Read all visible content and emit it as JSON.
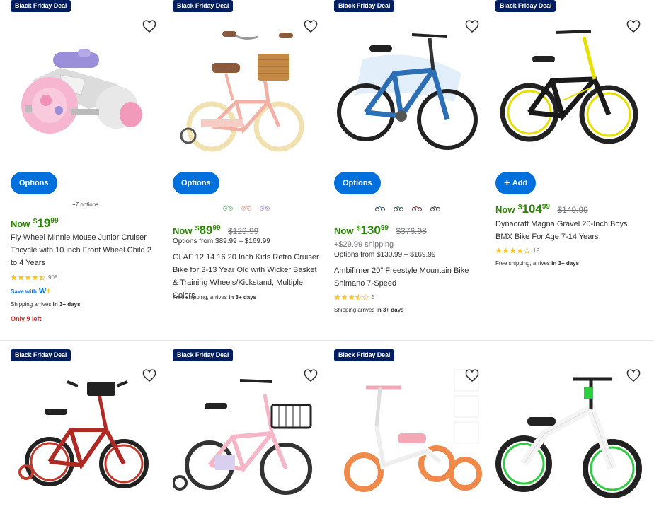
{
  "colors": {
    "green": "#2a8703",
    "blue": "#0071dc",
    "navy": "#001e60",
    "red": "#c22d2d",
    "star": "#ffc220"
  },
  "row1": [
    {
      "badge": "Black Friday Deal",
      "button": "Options",
      "more_options": "+7 options",
      "now": "Now",
      "currency": "$",
      "dollars": "19",
      "cents": "99",
      "title": "Fly Wheel Minnie Mouse Junior Cruiser Tricycle with 10 inch Front Wheel Child 2 to 4 Years",
      "rating": 4.5,
      "review_count": "908",
      "save_with": "Save with",
      "shipping_prefix": "Shipping arrives",
      "shipping_bold": "in 3+ days",
      "stock": "Only 9 left"
    },
    {
      "badge": "Black Friday Deal",
      "button": "Options",
      "swatch_icons": [
        "bike-swatch-icon",
        "bike-swatch-icon",
        "bike-swatch-icon"
      ],
      "now": "Now",
      "currency": "$",
      "dollars": "89",
      "cents": "99",
      "was": "$129.99",
      "options_range": "Options from $89.99 – $169.99",
      "title": "GLAF 12 14 16 20 Inch Kids Retro Cruiser Bike for 3-13 Year Old with Wicker Basket & Training Wheels/Kickstand, Multiple Colors",
      "shipping_prefix": "Free shipping, arrives",
      "shipping_bold": "in 3+ days"
    },
    {
      "badge": "Black Friday Deal",
      "button": "Options",
      "swatch_icons": [
        "bike-swatch-icon",
        "bike-swatch-icon",
        "bike-swatch-icon",
        "bike-swatch-icon"
      ],
      "now": "Now",
      "currency": "$",
      "dollars": "130",
      "cents": "99",
      "was": "$376.98",
      "shipping_cost": "+$29.99 shipping",
      "options_range": "Options from $130.99 – $169.99",
      "title": "Ambifirner 20\" Freestyle Mountain Bike Shimano 7-Speed",
      "rating": 3.5,
      "review_count": "5",
      "shipping_prefix": "Shipping arrives",
      "shipping_bold": "in 3+ days"
    },
    {
      "badge": "Black Friday Deal",
      "button": "Add",
      "now": "Now",
      "currency": "$",
      "dollars": "104",
      "cents": "99",
      "was": "$149.99",
      "title": "Dynacraft Magna Gravel 20-Inch Boys BMX Bike For Age 7-14 Years",
      "rating": 4.0,
      "review_count": "12",
      "shipping_prefix": "Free shipping, arrives",
      "shipping_bold": "in 3+ days"
    }
  ],
  "row2": [
    {
      "badge": "Black Friday Deal"
    },
    {
      "badge": "Black Friday Deal"
    },
    {
      "badge": "Black Friday Deal"
    },
    {}
  ]
}
